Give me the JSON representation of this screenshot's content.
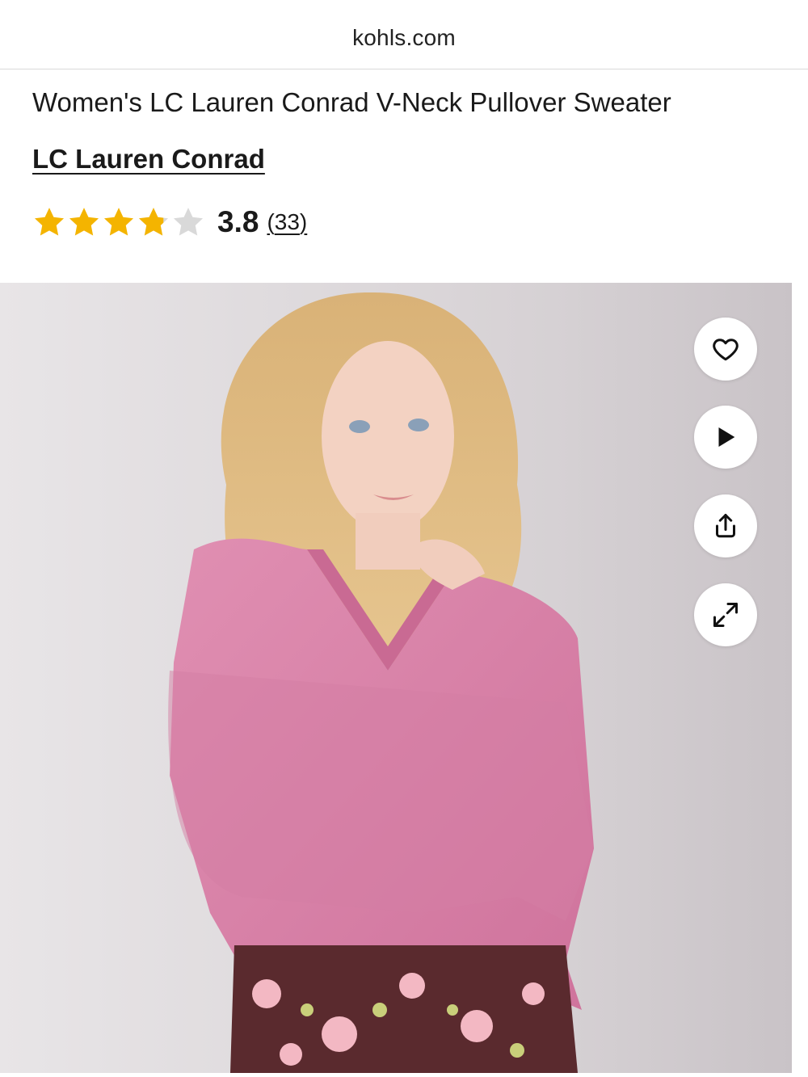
{
  "browser": {
    "url": "kohls.com"
  },
  "product": {
    "title": "Women's LC Lauren Conrad V-Neck Pullover Sweater",
    "brand": "LC Lauren Conrad",
    "rating": {
      "value": "3.8",
      "count": "33",
      "stars_filled": 3.8,
      "stars_total": 5
    }
  },
  "colors": {
    "star_filled": "#F4B400",
    "star_empty": "#D9D9D9",
    "sweater": "#D87FA6"
  },
  "icons": [
    "heart-icon",
    "play-icon",
    "share-icon",
    "expand-icon"
  ]
}
